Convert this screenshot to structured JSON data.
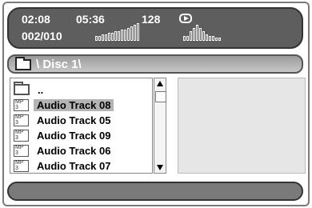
{
  "status": {
    "elapsed": "02:08",
    "total": "05:36",
    "bitrate": "128",
    "track_counter": "002/010",
    "play_state_icon": "play-icon",
    "level_meter_left": [
      3,
      3,
      4,
      4,
      5,
      5,
      6,
      6,
      7,
      7,
      8,
      9,
      10,
      11
    ],
    "level_meter_right": [
      3,
      3,
      6,
      8,
      10,
      8,
      6,
      4,
      3,
      3,
      2,
      2
    ]
  },
  "path": {
    "folder_icon": "folder-icon",
    "text": "\\ Disc 1\\"
  },
  "filelist": {
    "parent_label": "..",
    "items": [
      {
        "icon_text": "MP 3",
        "label": "Audio Track  08",
        "selected": true
      },
      {
        "icon_text": "MP 3",
        "label": "Audio Track  05",
        "selected": false
      },
      {
        "icon_text": "MP 3",
        "label": "Audio Track  09",
        "selected": false
      },
      {
        "icon_text": "MP 3",
        "label": "Audio Track  06",
        "selected": false
      },
      {
        "icon_text": "MP 3",
        "label": "Audio Track  07",
        "selected": false
      }
    ]
  },
  "colors": {
    "status_bg": "#5e5e5e",
    "selection": "#b4b4b4",
    "preview_bg": "#e6e6e6"
  }
}
